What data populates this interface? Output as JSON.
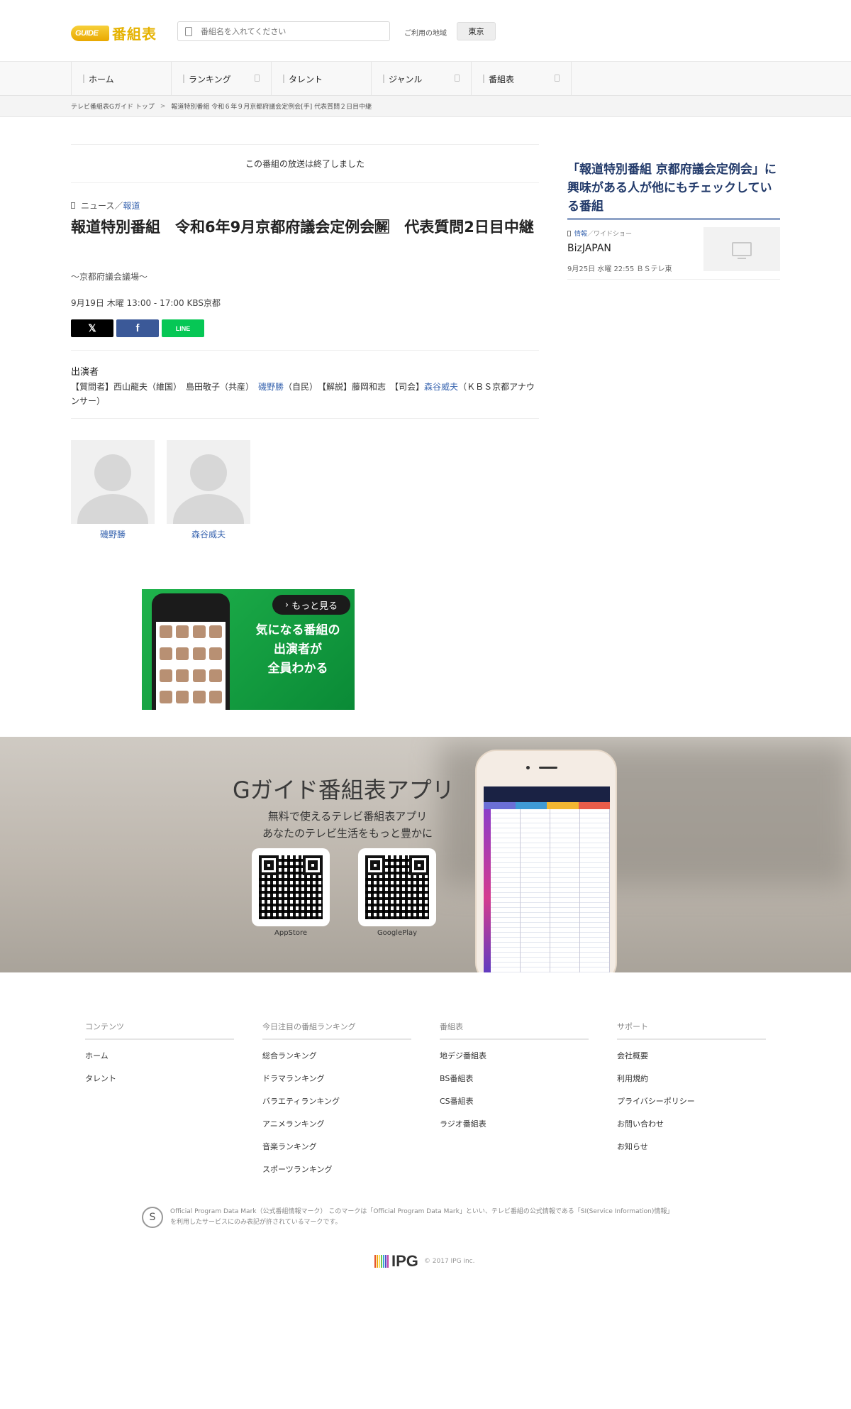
{
  "header": {
    "logo_badge": "GUIDE",
    "logo_text": "番組表",
    "search_placeholder": "番組名を入れてください",
    "region_label": "ご利用の地域",
    "region_value": "東京"
  },
  "nav": {
    "items": [
      {
        "label": "ホーム"
      },
      {
        "label": "ランキング"
      },
      {
        "label": "タレント"
      },
      {
        "label": "ジャンル"
      },
      {
        "label": "番組表"
      }
    ]
  },
  "breadcrumb": {
    "home": "テレビ番組表Gガイド トップ",
    "sep": ">",
    "current": "報道特別番組 令和６年９月京都府議会定例会[手] 代表質問２日目中継"
  },
  "program": {
    "status": "この番組の放送は終了しました",
    "genre_main": "ニュース",
    "genre_sep": "／",
    "genre_sub": "報道",
    "title": "報道特別番組　令和6年9月京都府議会定例会🈖　代表質問2日目中継",
    "subtitle": "〜京都府議会議場〜",
    "airtime": "9月19日 木曜 13:00 - 17:00 KBS京都",
    "share": {
      "x": "𝕏",
      "facebook": "f",
      "line": "LINE"
    },
    "cast_heading": "出演者",
    "cast": {
      "p1": "【質問者】西山龍夫（維国）　島田敬子（共産）　",
      "link1": "磯野勝",
      "p2": "（自民）　【解説】藤岡和志　【司会】",
      "link2": "森谷威夫",
      "p3": "（ＫＢＳ京都アナウンサー）"
    },
    "performers": [
      {
        "name": "磯野勝"
      },
      {
        "name": "森谷威夫"
      }
    ]
  },
  "promo": {
    "more_label": "もっと見る",
    "copy_line1": "気になる番組の",
    "copy_line2": "出演者が",
    "copy_line3": "全員わかる"
  },
  "app": {
    "title": "Gガイド番組表アプリ",
    "desc_line1": "無料で使えるテレビ番組表アプリ",
    "desc_line2": "あなたのテレビ生活をもっと豊かに",
    "store_ios": "AppStore",
    "store_android": "GooglePlay"
  },
  "sidebar": {
    "heading": "「報道特別番組 京都府議会定例会」に興味がある人が他にもチェックしている番組",
    "item": {
      "genre_main": "情報",
      "genre_sub": "／ワイドショー",
      "title": "BizJAPAN",
      "meta": "9月25日 水曜 22:55 ＢＳテレ東"
    }
  },
  "footer": {
    "columns": [
      {
        "heading": "コンテンツ",
        "links": [
          "ホーム",
          "タレント"
        ]
      },
      {
        "heading": "今日注目の番組ランキング",
        "links": [
          "総合ランキング",
          "ドラマランキング",
          "バラエティランキング",
          "アニメランキング",
          "音楽ランキング",
          "スポーツランキング"
        ]
      },
      {
        "heading": "番組表",
        "links": [
          "地デジ番組表",
          "BS番組表",
          "CS番組表",
          "ラジオ番組表"
        ]
      },
      {
        "heading": "サポート",
        "links": [
          "会社概要",
          "利用規約",
          "プライバシーポリシー",
          "お問い合わせ",
          "お知らせ"
        ]
      }
    ],
    "opd_mark": "S",
    "opd_line1": "Official Program Data Mark（公式番組情報マーク） このマークは「Official Program Data Mark」といい、テレビ番組の公式情報である「SI(Service Information)情報」",
    "opd_line2": "を利用したサービスにのみ表記が許されているマークです。",
    "ipg_logo": "IPG",
    "copyright": "© 2017 IPG inc."
  }
}
